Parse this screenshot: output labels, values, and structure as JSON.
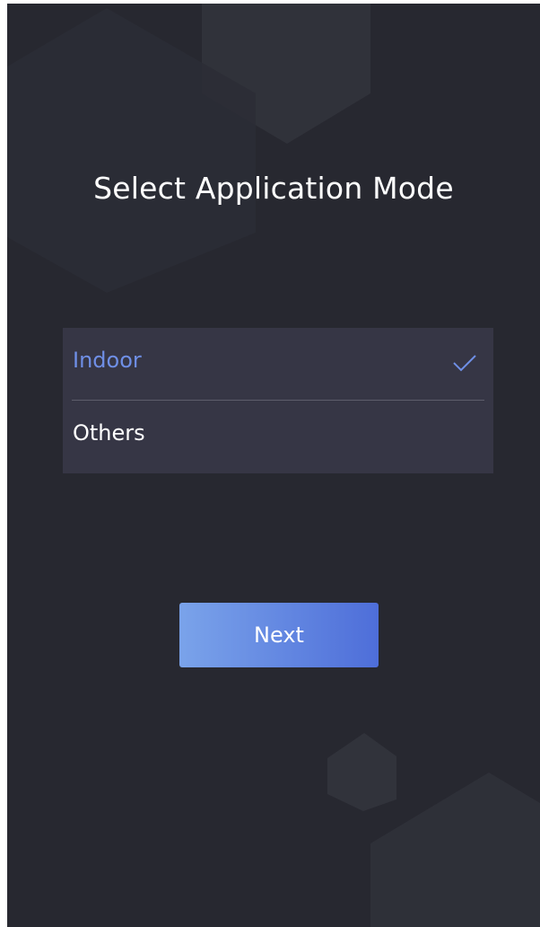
{
  "screen": {
    "title": "Select Application Mode"
  },
  "modes": [
    {
      "label": "Indoor",
      "selected": true
    },
    {
      "label": "Others",
      "selected": false
    }
  ],
  "next_button": {
    "label": "Next"
  },
  "colors": {
    "background": "#272830",
    "list_background": "#363645",
    "selected_text": "#6f8fe6",
    "button_gradient_start": "#7aa3ea",
    "button_gradient_end": "#4e6ed9"
  },
  "icons": {
    "selected_mark": "check-icon"
  }
}
